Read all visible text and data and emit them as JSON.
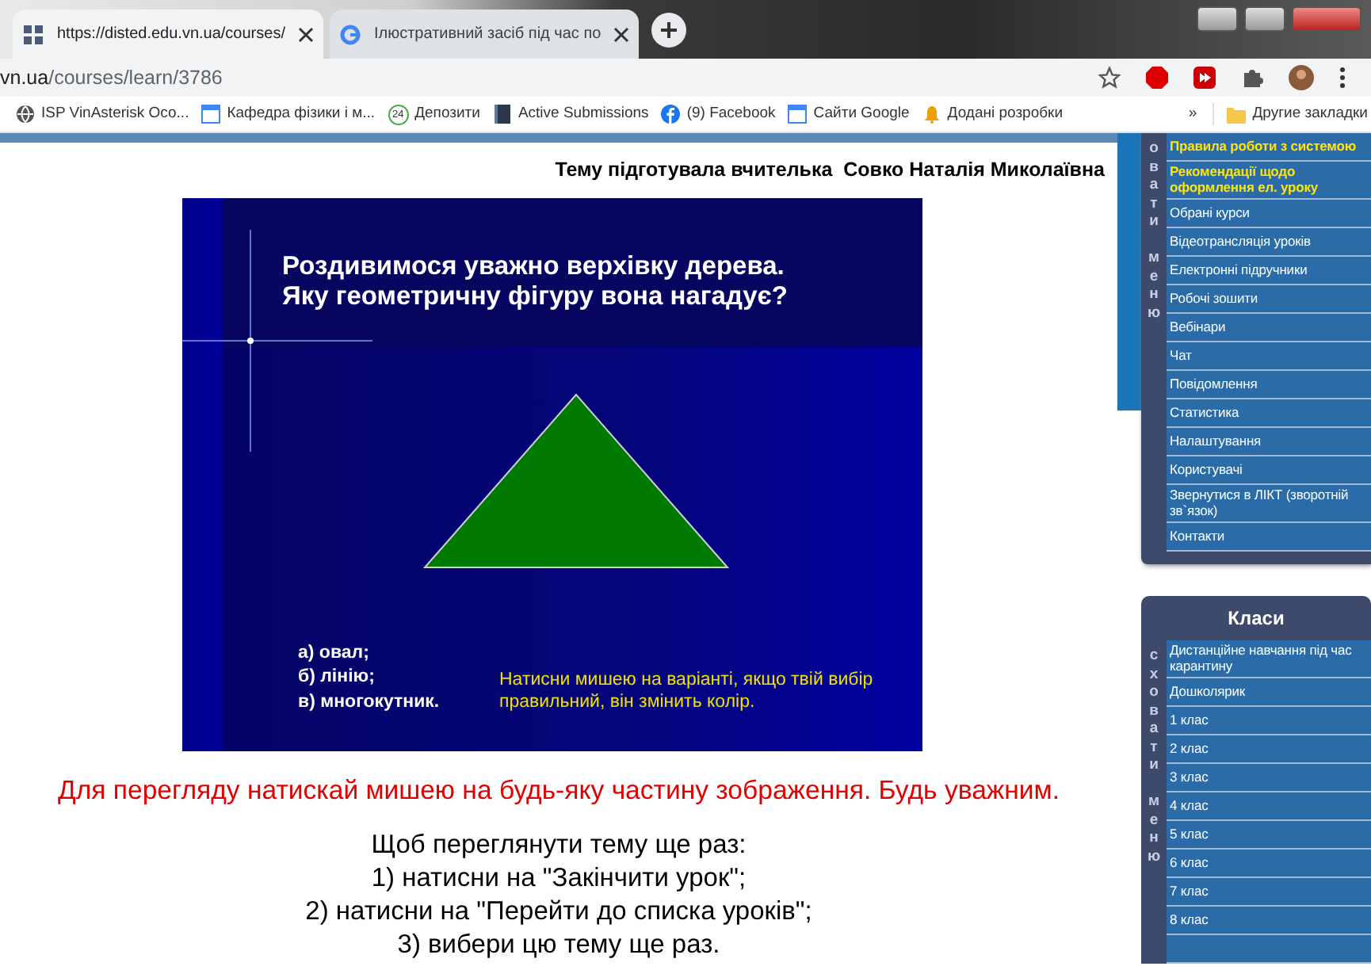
{
  "browser": {
    "tabs": [
      {
        "title": "https://disted.edu.vn.ua/courses/",
        "selected": true,
        "kind": "grid"
      },
      {
        "title": "Ілюстративний засіб під час по",
        "selected": false,
        "kind": "google"
      }
    ],
    "address": {
      "host": "vn.ua",
      "path": "/courses/learn/3786"
    },
    "bookmarks": [
      {
        "label": "ISP VinAsterisk Осо...",
        "kind": "globe"
      },
      {
        "label": "Кафедра фізики і м...",
        "kind": "page"
      },
      {
        "label": "Депозити",
        "kind": "counter",
        "badge": "24"
      },
      {
        "label": "Active Submissions",
        "kind": "book"
      },
      {
        "label": "(9) Facebook",
        "kind": "facebook"
      },
      {
        "label": "Сайти Google",
        "kind": "page"
      },
      {
        "label": "Додані розробки",
        "kind": "bell"
      }
    ],
    "more": "»",
    "other_bookmarks": "Другие закладки"
  },
  "lesson": {
    "author": "Тему підготувала вчителька  Совко Наталія Миколаївна",
    "slide": {
      "title": [
        "Роздивимося уважно верхівку дерева.",
        "Яку геометричну фігуру вона нагадує?"
      ],
      "options": [
        "а) овал;",
        "б) лінію;",
        "в) многокутник."
      ],
      "hint": "Натисни мишею на варіанті, якщо твій вибір правильний, він змінить колір."
    },
    "notice": "Для перегляду натискай мишею на будь-яку частину зображення. Будь уважним.",
    "instructions": [
      "Щоб переглянути тему ще раз:",
      "1) натисни на \"Закінчити урок\";",
      "2) натисни на \"Перейти до списка уроків\";",
      "3) вибери цю тему ще раз."
    ]
  },
  "menu": {
    "toggle_label": "овати меню",
    "items": [
      {
        "label": "Правила роботи з системою",
        "highlighted": true
      },
      {
        "label": "Рекомендації щодо оформлення ел. уроку",
        "highlighted": true
      },
      {
        "label": "Обрані курси",
        "highlighted": false
      },
      {
        "label": "Відеотрансляція уроків",
        "highlighted": false
      },
      {
        "label": "Електронні підручники",
        "highlighted": false
      },
      {
        "label": "Робочі зошити",
        "highlighted": false
      },
      {
        "label": "Вебінари",
        "highlighted": false
      },
      {
        "label": "Чат",
        "highlighted": false
      },
      {
        "label": "Повідомлення",
        "highlighted": false
      },
      {
        "label": "Статистика",
        "highlighted": false
      },
      {
        "label": "Налаштування",
        "highlighted": false
      },
      {
        "label": "Користувачі",
        "highlighted": false
      },
      {
        "label": "Звернутися в ЛІКТ (зворотній зв`язок)",
        "highlighted": false
      },
      {
        "label": "Контакти",
        "highlighted": false
      }
    ]
  },
  "classes": {
    "title": "Класи",
    "toggle_label": "сховати меню",
    "items": [
      {
        "label": "Дистанційне навчання під час карантину"
      },
      {
        "label": "Дошколярик"
      },
      {
        "label": "1 клас"
      },
      {
        "label": "2 клас"
      },
      {
        "label": "3 клас"
      },
      {
        "label": "4 клас"
      },
      {
        "label": "5 клас"
      },
      {
        "label": "6 клас"
      },
      {
        "label": "7 клас"
      },
      {
        "label": "8 клас"
      }
    ]
  }
}
